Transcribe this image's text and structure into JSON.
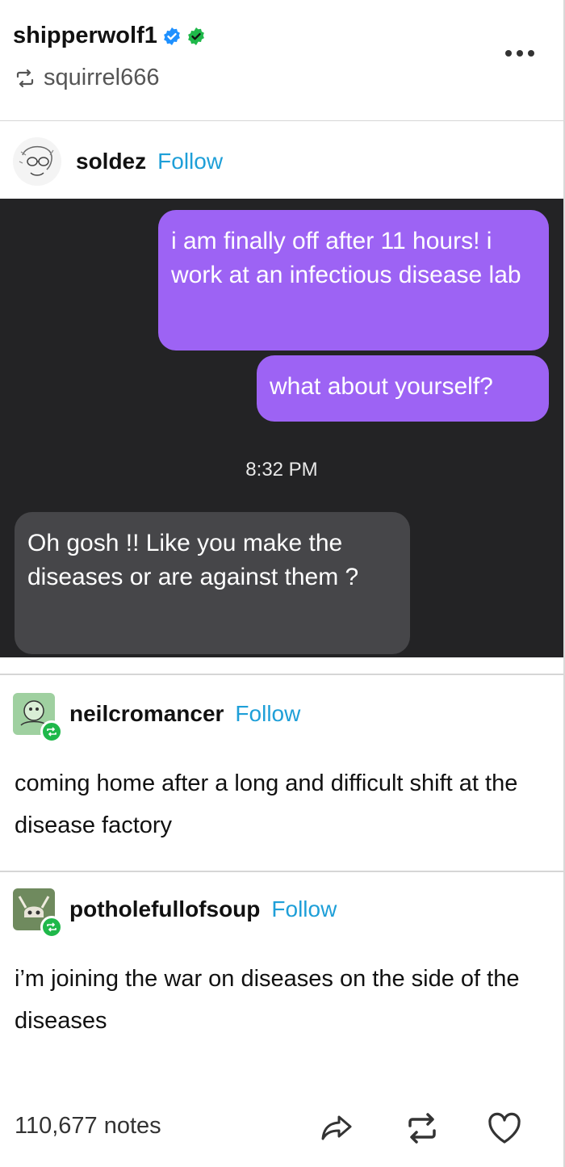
{
  "header": {
    "author": "shipperwolf1",
    "reblogged_from": "squirrel666",
    "verified_colors": [
      "#1e90ff",
      "#1fb84a"
    ]
  },
  "trail": [
    {
      "username": "soldez",
      "follow_label": "Follow",
      "avatar_icon": "sketch-face-avatar",
      "chat": {
        "messages_out": [
          "i am finally off after 11 hours! i work at an infectious disease lab",
          "what about yourself?"
        ],
        "timestamp": "8:32 PM",
        "messages_in": [
          "Oh gosh !! Like you make the diseases or are against them ?"
        ]
      }
    },
    {
      "username": "neilcromancer",
      "follow_label": "Follow",
      "avatar_icon": "green-creature-avatar",
      "text": "coming home after a long and difficult shift at the disease factory"
    },
    {
      "username": "potholefullofsoup",
      "follow_label": "Follow",
      "avatar_icon": "skull-avatar",
      "text": "i’m joining the war on diseases on the side of the diseases"
    }
  ],
  "footer": {
    "notes": "110,677 notes",
    "actions": [
      "share-icon",
      "reblog-icon",
      "like-icon"
    ]
  },
  "colors": {
    "accent_follow": "#1e9fd8",
    "bubble_out": "#9d63f4",
    "bubble_in": "#464649",
    "chat_bg": "#232325",
    "reblog_badge": "#1fb84a"
  }
}
